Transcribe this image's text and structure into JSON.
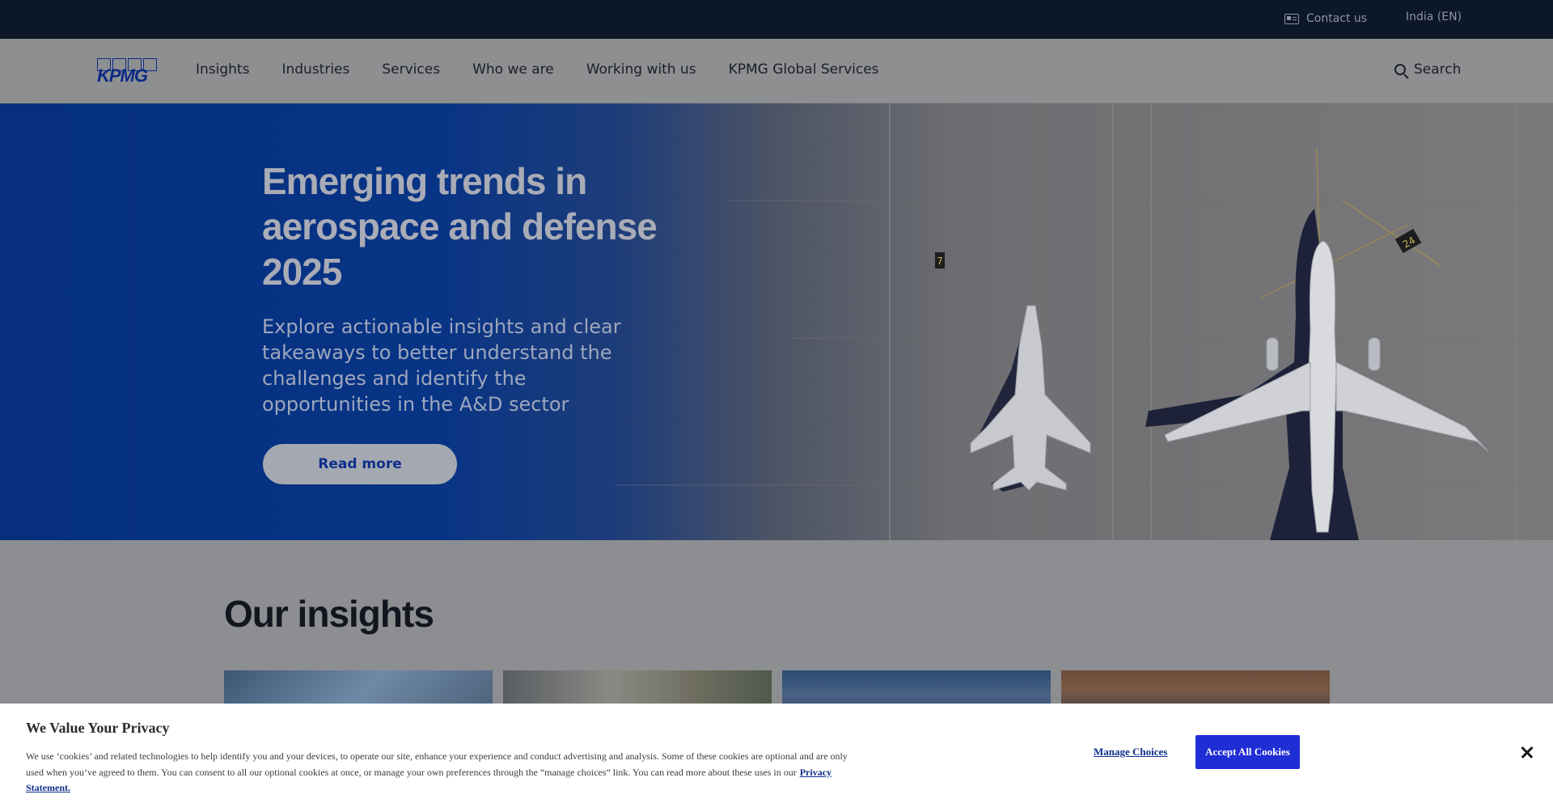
{
  "topbar": {
    "contact_label": "Contact us",
    "contact_icon": "contact-card-icon",
    "locale_label": "India (EN)"
  },
  "nav": {
    "logo_text": "KPMG",
    "items": [
      {
        "label": "Insights"
      },
      {
        "label": "Industries"
      },
      {
        "label": "Services"
      },
      {
        "label": "Who we are"
      },
      {
        "label": "Working with us"
      },
      {
        "label": "KPMG Global Services"
      }
    ],
    "search_label": "Search",
    "search_icon": "search-icon"
  },
  "hero": {
    "title": "Emerging trends in aerospace and defense 2025",
    "description": "Explore actionable insights and clear takeaways to better understand the challenges and identify the opportunities in the A&D sector",
    "cta_label": "Read more",
    "stand_labels": [
      "7",
      "24"
    ]
  },
  "insights": {
    "heading": "Our insights"
  },
  "cookie_banner": {
    "title": "We Value Your Privacy",
    "body": "We use ‘cookies’ and related technologies to help identify you and your devices, to operate our site, enhance your experience and conduct advertising and analysis. Some of these cookies are optional and are only used when you’ve agreed to them. You can consent to all our optional cookies at once, or manage your own preferences through the “manage choices” link. You can read more about these uses in our",
    "privacy_link": "Privacy Statement.",
    "manage_label": "Manage Choices",
    "accept_label": "Accept All Cookies",
    "close_icon": "close-icon",
    "accent_color": "#1f2ed4"
  }
}
